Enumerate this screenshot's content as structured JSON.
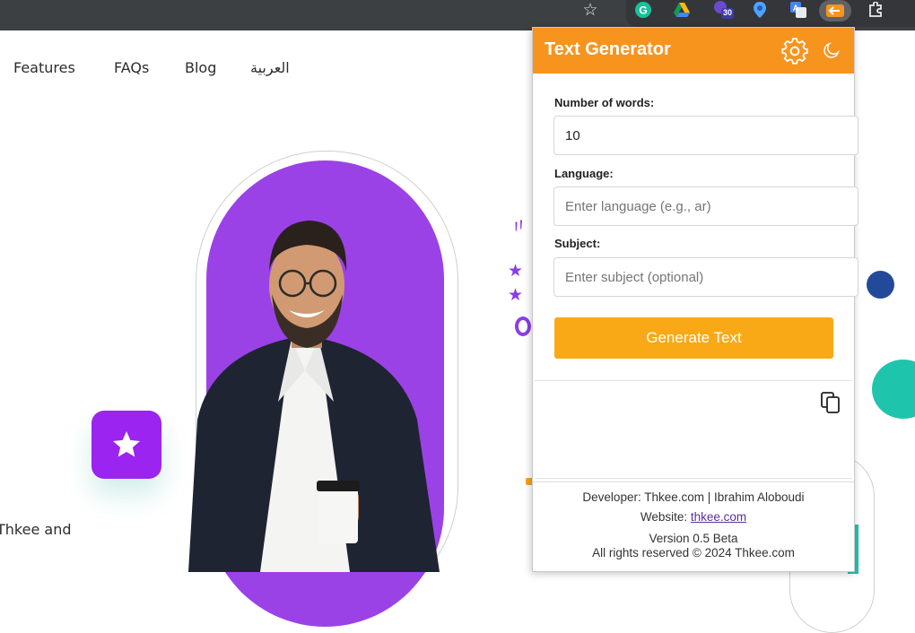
{
  "site_nav": {
    "features": "Features",
    "faqs": "FAQs",
    "blog": "Blog",
    "arabic": "العربية"
  },
  "hero": {
    "partial_text": "Thkee and"
  },
  "browser": {
    "extension_badge": "30",
    "icons": [
      "bookmark-star-icon",
      "grammarly-icon",
      "google-drive-icon",
      "calendar-badge-icon",
      "location-pin-icon",
      "translate-icon",
      "text-generator-extension-icon",
      "puzzle-extensions-icon"
    ]
  },
  "popup": {
    "title": "Text Generator",
    "header_color": "#f7941d",
    "words_label": "Number of words:",
    "words_value": "10",
    "language_label": "Language:",
    "language_placeholder": "Enter language (e.g., ar)",
    "subject_label": "Subject:",
    "subject_placeholder": "Enter subject (optional)",
    "generate_button": "Generate Text",
    "button_color": "#f9a915",
    "footer": {
      "developer": "Developer: Thkee.com | Ibrahim Aloboudi",
      "website_label": "Website: ",
      "website_link": "thkee.com",
      "version": "Version 0.5 Beta",
      "rights": "All rights reserved © 2024 Thkee.com"
    }
  },
  "colors": {
    "purple": "#9b42e6",
    "teal": "#1ec5ac",
    "navy": "#234a9a"
  }
}
